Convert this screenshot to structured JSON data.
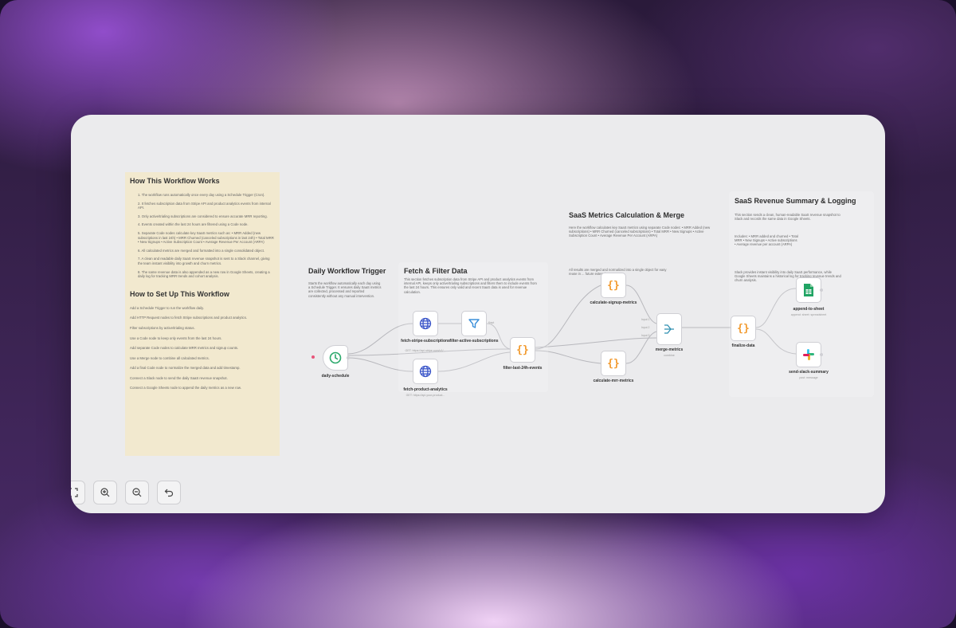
{
  "notes": {
    "how_title": "How This Workflow Works",
    "how_steps": [
      "1. The workflow runs automatically once every day using a Schedule Trigger (Cron).",
      "2. It fetches subscription data from Stripe API and product analytics events from internal API.",
      "3. Only active/trialing subscriptions are considered to ensure accurate MRR reporting.",
      "4. Events created within the last 24 hours are filtered using a Code node.",
      "5. Separate Code nodes calculate key SaaS metrics such as: • MRR Added (new subscriptions in last 24h) • MRR Churned (canceled subscriptions in last 24h) • Total MRR • New Signups • Active Subscription Count • Average Revenue Per Account (ARPA)",
      "6. All calculated metrics are merged and formatted into a single consolidated object.",
      "7. A clean and readable daily SaaS revenue snapshot is sent to a Slack channel, giving the team instant visibility into growth and churn metrics.",
      "8. The same revenue data is also appended as a new row in Google Sheets, creating a daily log for tracking MRR trends and cohort analysis."
    ],
    "setup_title": "How to Set Up This Workflow",
    "setup_steps": [
      "Add a Schedule Trigger to run the workflow daily.",
      "Add HTTP Request nodes to fetch Stripe subscriptions and product analytics.",
      "Filter subscriptions by active/trialing status.",
      "Use a Code node to keep only events from the last 24 hours.",
      "Add separate Code nodes to calculate MRR metrics and signup counts.",
      "Use a Merge node to combine all calculated metrics.",
      "Add a final Code node to normalize the merged data and add timestamp.",
      "Connect a Slack node to send the daily SaaS revenue snapshot.",
      "Connect a Google Sheets node to append the daily metrics as a new row."
    ]
  },
  "sections": {
    "trigger": {
      "title": "Daily Workflow Trigger",
      "text": "Starts the workflow automatically each day using a Schedule Trigger. It ensures daily SaaS metrics are collected, processed and reported consistently without any manual intervention."
    },
    "fetch": {
      "title": "Fetch & Filter Data",
      "text": "This section fetches subscription data from Stripe API and product analytics events from internal API, keeps only active/trialing subscriptions and filters them to include events from the last 24 hours. This ensures only valid and recent SaaS data is used for revenue calculation."
    },
    "metrics": {
      "title": "SaaS Metrics Calculation & Merge",
      "text": "Here the workflow calculates key SaaS metrics using separate Code nodes: • MRR Added (new subscriptions) • MRR Churned (canceled subscriptions) • Total MRR • New Signups • Active Subscription Count • Average Revenue Per Account (ARPA)",
      "text2": "All results are merged and normalized into a single object for easy reuse in ... future extensions."
    },
    "summary": {
      "title": "SaaS Revenue Summary & Logging",
      "text": "This section sends a clean, human-readable SaaS revenue snapshot to Slack and records the same data in Google Sheets.",
      "includes": "Includes: • MRR added and churned • Total MRR • New Signups • Active subscriptions • Average revenue per account (ARPA)",
      "text2": "Slack provides instant visibility into daily SaaS performance, while Google Sheets maintains a historical log for tracking revenue trends and churn analysis."
    }
  },
  "nodes": {
    "daily_schedule": {
      "label": "daily-schedule"
    },
    "fetch_stripe": {
      "label": "fetch-stripe-subscriptions",
      "sub": "GET: https://api.stripe.com/v1/..."
    },
    "filter_active": {
      "label": "filter-active-subscriptions"
    },
    "fetch_product": {
      "label": "fetch-product-analytics",
      "sub": "GET: https://api.your-product..."
    },
    "filter_24h": {
      "label": "filter-last-24h-events"
    },
    "calc_signup": {
      "label": "calculate-signup-metrics"
    },
    "calc_mrr": {
      "label": "calculate-mrr-metrics"
    },
    "merge": {
      "label": "merge-metrics",
      "sub": "combine",
      "in1": "Input 1",
      "in2": "Input 2",
      "in3": "Input 3"
    },
    "finalize": {
      "label": "finalize-data"
    },
    "append_sheet": {
      "label": "append-to-sheet",
      "sub": "append: sheet: spreadsheet"
    },
    "slack": {
      "label": "send-slack-summary",
      "sub": "post: message"
    },
    "filter_kept": "Kept"
  },
  "controls": {
    "fit": "fit-view-icon",
    "zoom_in": "zoom-in-icon",
    "zoom_out": "zoom-out-icon",
    "undo": "undo-icon"
  },
  "colors": {
    "canvas": "#ebebed",
    "sticky": "#f2e9cf",
    "schedule": "#2aa86a",
    "http": "#3b56c9",
    "filter": "#3b8fd9",
    "code": "#f29a2e",
    "merge": "#2f8fb0",
    "sheets": "#21a464"
  }
}
